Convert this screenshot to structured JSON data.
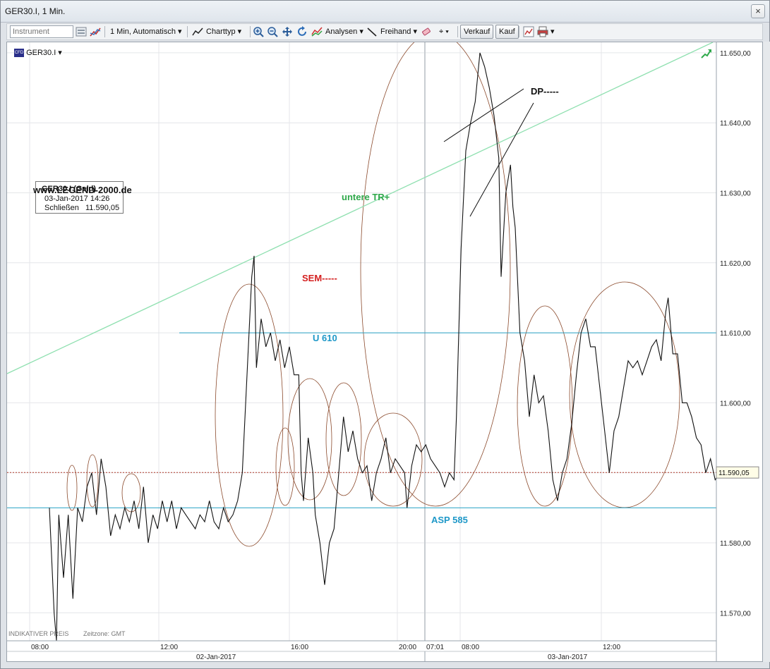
{
  "window": {
    "title": "GER30.I, 1 Min.",
    "close_label": "×"
  },
  "toolbar": {
    "instrument_placeholder": "Instrument",
    "interval_label": "1 Min, Automatisch",
    "charttype_label": "Charttyp",
    "analysen_label": "Analysen",
    "freihand_label": "Freihand",
    "verkauf_label": "Verkauf",
    "kauf_label": "Kauf"
  },
  "symbol_selector": {
    "label": "GER30.I"
  },
  "info_box": {
    "title": "GER30.I (Geld)",
    "datetime": "03-Jan-2017 14:26",
    "close_label": "Schließen",
    "close_value": "11.590,05"
  },
  "watermark": "www.LEGEND-2000.de",
  "footer": {
    "indikativ": "INDIKATIVER PREIS",
    "zeitzone": "Zeitzone: GMT"
  },
  "colors": {
    "price_line": "#111111",
    "level_line": "#2aa2c4",
    "trend_line": "#8fe0b0",
    "ellipse": "#8b4a2c",
    "current_price_line": "#b23a2a",
    "label_green": "#2ea84a",
    "label_red": "#d42020",
    "label_blue": "#1e98c8"
  },
  "chart_data": {
    "type": "line",
    "title": "",
    "y_ticks": [
      11570,
      11580,
      11590,
      11600,
      11610,
      11620,
      11630,
      11640,
      11650
    ],
    "y_tick_labels": [
      "11.570,00",
      "11.580,00",
      "11.590,00",
      "11.600,00",
      "11.610,00",
      "11.620,00",
      "11.630,00",
      "11.640,00",
      "11.650,00"
    ],
    "ylim": [
      11566,
      11651.5
    ],
    "x_tick_labels": [
      "08:00",
      "12:00",
      "16:00",
      "20:00",
      "07:01",
      "08:00",
      "12:00"
    ],
    "x_date_labels": [
      "02-Jan-2017",
      "03-Jan-2017"
    ],
    "grid": true,
    "current_price": {
      "value": 11590.05,
      "label": "11.590,05"
    },
    "levels": [
      {
        "name": "U 610",
        "value": 11610
      },
      {
        "name": "ASP 585",
        "value": 11585
      }
    ],
    "annotations": [
      {
        "text": "untere TR+",
        "kind": "trendline"
      },
      {
        "text": "SEM-----",
        "kind": "label"
      },
      {
        "text": "DP-----",
        "kind": "label"
      },
      {
        "text": "U 610",
        "kind": "level"
      },
      {
        "text": "ASP 585",
        "kind": "level"
      }
    ],
    "series": [
      {
        "values": [
          [
            0,
            11585
          ],
          [
            2,
            11570
          ],
          [
            3,
            11566
          ],
          [
            4,
            11584
          ],
          [
            6,
            11575
          ],
          [
            8,
            11584
          ],
          [
            10,
            11572
          ],
          [
            12,
            11585
          ],
          [
            14,
            11583
          ],
          [
            16,
            11588
          ],
          [
            18,
            11590
          ],
          [
            20,
            11584
          ],
          [
            22,
            11592
          ],
          [
            24,
            11588
          ],
          [
            26,
            11581
          ],
          [
            28,
            11584
          ],
          [
            30,
            11582
          ],
          [
            32,
            11585
          ],
          [
            34,
            11583
          ],
          [
            36,
            11586
          ],
          [
            38,
            11582
          ],
          [
            40,
            11588
          ],
          [
            42,
            11580
          ],
          [
            44,
            11584
          ],
          [
            46,
            11582
          ],
          [
            48,
            11586
          ],
          [
            50,
            11583
          ],
          [
            52,
            11586
          ],
          [
            54,
            11582
          ],
          [
            56,
            11585
          ],
          [
            58,
            11584
          ],
          [
            60,
            11583
          ],
          [
            62,
            11582
          ],
          [
            64,
            11584
          ],
          [
            66,
            11583
          ],
          [
            68,
            11586
          ],
          [
            70,
            11583
          ],
          [
            72,
            11582
          ],
          [
            74,
            11585
          ],
          [
            76,
            11583
          ],
          [
            78,
            11584
          ],
          [
            80,
            11586
          ],
          [
            82,
            11590
          ],
          [
            84,
            11604
          ],
          [
            86,
            11618
          ],
          [
            87,
            11621
          ],
          [
            88,
            11605
          ],
          [
            90,
            11612
          ],
          [
            92,
            11608
          ],
          [
            94,
            11610
          ],
          [
            96,
            11606
          ],
          [
            98,
            11609
          ],
          [
            100,
            11605
          ],
          [
            102,
            11608
          ],
          [
            104,
            11604
          ],
          [
            106,
            11604
          ],
          [
            107,
            11590
          ],
          [
            108,
            11586
          ],
          [
            110,
            11595
          ],
          [
            112,
            11590
          ],
          [
            113,
            11584
          ],
          [
            115,
            11580
          ],
          [
            117,
            11574
          ],
          [
            119,
            11580
          ],
          [
            121,
            11582
          ],
          [
            123,
            11590
          ],
          [
            125,
            11598
          ],
          [
            127,
            11593
          ],
          [
            129,
            11596
          ],
          [
            131,
            11592
          ],
          [
            133,
            11590
          ],
          [
            135,
            11591
          ],
          [
            137,
            11586
          ],
          [
            139,
            11590
          ],
          [
            141,
            11592
          ],
          [
            143,
            11595
          ],
          [
            145,
            11590
          ],
          [
            147,
            11592
          ],
          [
            149,
            11591
          ],
          [
            151,
            11590
          ],
          [
            152,
            11585
          ],
          [
            154,
            11591
          ],
          [
            156,
            11594
          ],
          [
            158,
            11593
          ],
          [
            160,
            11594
          ],
          [
            162,
            11592
          ],
          [
            164,
            11591
          ],
          [
            166,
            11590
          ],
          [
            168,
            11588
          ],
          [
            170,
            11590
          ],
          [
            172,
            11589
          ],
          [
            173,
            11598
          ],
          [
            175,
            11622
          ],
          [
            177,
            11636
          ],
          [
            179,
            11640
          ],
          [
            181,
            11643
          ],
          [
            183,
            11650
          ],
          [
            185,
            11648
          ],
          [
            187,
            11645
          ],
          [
            189,
            11641
          ],
          [
            191,
            11635
          ],
          [
            192,
            11618
          ],
          [
            194,
            11630
          ],
          [
            196,
            11634
          ],
          [
            197,
            11628
          ],
          [
            198,
            11625
          ],
          [
            200,
            11610
          ],
          [
            202,
            11606
          ],
          [
            204,
            11598
          ],
          [
            206,
            11604
          ],
          [
            208,
            11600
          ],
          [
            210,
            11601
          ],
          [
            212,
            11596
          ],
          [
            214,
            11589
          ],
          [
            216,
            11586
          ],
          [
            218,
            11590
          ],
          [
            220,
            11592
          ],
          [
            222,
            11597
          ],
          [
            224,
            11604
          ],
          [
            226,
            11610
          ],
          [
            228,
            11612
          ],
          [
            230,
            11608
          ],
          [
            232,
            11608
          ],
          [
            234,
            11602
          ],
          [
            236,
            11596
          ],
          [
            238,
            11590
          ],
          [
            240,
            11596
          ],
          [
            242,
            11598
          ],
          [
            244,
            11602
          ],
          [
            246,
            11606
          ],
          [
            248,
            11605
          ],
          [
            250,
            11606
          ],
          [
            252,
            11604
          ],
          [
            254,
            11606
          ],
          [
            256,
            11608
          ],
          [
            258,
            11609
          ],
          [
            260,
            11606
          ],
          [
            262,
            11613
          ],
          [
            263,
            11615
          ],
          [
            265,
            11607
          ],
          [
            267,
            11607
          ],
          [
            269,
            11600
          ],
          [
            271,
            11600
          ],
          [
            273,
            11598
          ],
          [
            275,
            11595
          ],
          [
            277,
            11594
          ],
          [
            279,
            11590
          ],
          [
            281,
            11592
          ],
          [
            283,
            11589
          ],
          [
            285,
            11590
          ]
        ]
      }
    ]
  }
}
